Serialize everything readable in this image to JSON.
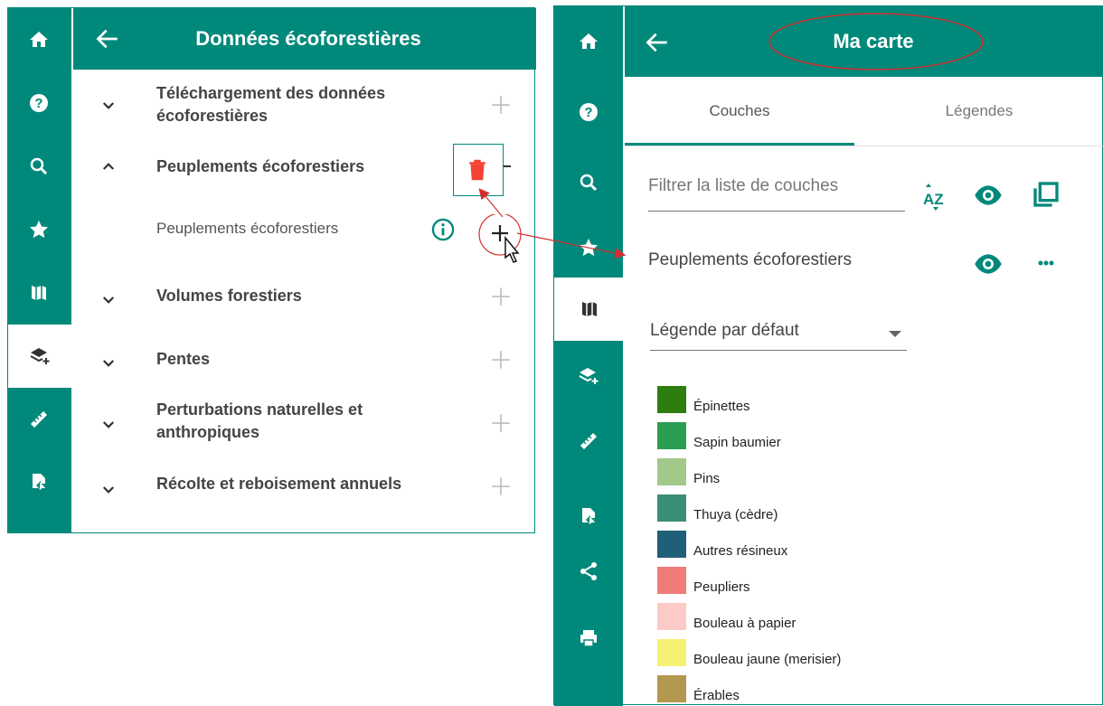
{
  "left_panel": {
    "title": "Données écoforestières",
    "categories": [
      {
        "label_line1": "Téléchargement des données",
        "label_line2": "écoforestières"
      },
      {
        "label_line1": "Peuplements écoforestiers",
        "label_line2": ""
      },
      {
        "label_line1": "Volumes forestiers",
        "label_line2": ""
      },
      {
        "label_line1": "Pentes",
        "label_line2": ""
      },
      {
        "label_line1": "Perturbations naturelles et",
        "label_line2": "anthropiques"
      },
      {
        "label_line1": "Récolte et reboisement annuels",
        "label_line2": ""
      }
    ],
    "sub_item": {
      "label": "Peuplements écoforestiers"
    }
  },
  "right_panel": {
    "title": "Ma carte",
    "tabs": [
      {
        "label": "Couches",
        "active": true
      },
      {
        "label": "Légendes",
        "active": false
      }
    ],
    "filter": {
      "placeholder": "Filtrer la liste de couches"
    },
    "layer": {
      "name": "Peuplements écoforestiers"
    },
    "legend_select": {
      "value": "Légende par défaut"
    },
    "legend": [
      {
        "label": "Épinettes",
        "color": "#2e7d0f"
      },
      {
        "label": "Sapin baumier",
        "color": "#2a9e4f"
      },
      {
        "label": "Pins",
        "color": "#a2c98a"
      },
      {
        "label": "Thuya (cèdre)",
        "color": "#3a8e76"
      },
      {
        "label": "Autres résineux",
        "color": "#1f5f78"
      },
      {
        "label": "Peupliers",
        "color": "#f07b78"
      },
      {
        "label": "Bouleau à papier",
        "color": "#fccbc8"
      },
      {
        "label": "Bouleau jaune (merisier)",
        "color": "#f4f175"
      },
      {
        "label": "Érables",
        "color": "#b5984f"
      }
    ]
  },
  "colors": {
    "accent": "#00897b",
    "delete": "#f44336",
    "annotation": "#d32f2f"
  }
}
